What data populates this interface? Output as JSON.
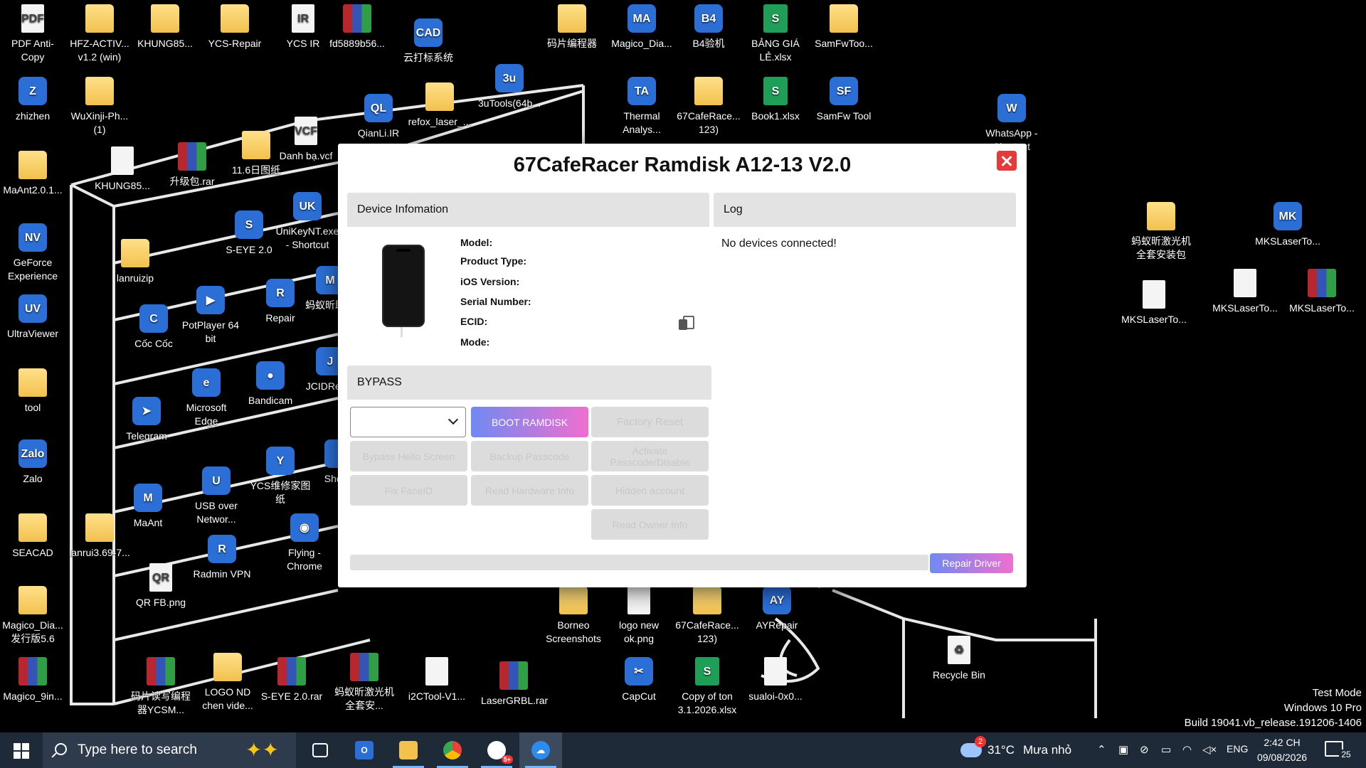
{
  "desktop_icons": [
    {
      "label": "PDF Anti-Copy",
      "type": "doc",
      "glyph": "PDF"
    },
    {
      "label": "HFZ-ACTIV... v1.2 (win)",
      "type": "folder",
      "glyph": ""
    },
    {
      "label": "KHUNG85...",
      "type": "folder",
      "glyph": ""
    },
    {
      "label": "YCS-Repair",
      "type": "folder",
      "glyph": ""
    },
    {
      "label": "YCS IR",
      "type": "doc",
      "glyph": "IR"
    },
    {
      "label": "fd5889b56...",
      "type": "rar",
      "glyph": ""
    },
    {
      "label": "云打标系统",
      "type": "app",
      "glyph": "CAD"
    },
    {
      "label": "码片编程器",
      "type": "folder",
      "glyph": ""
    },
    {
      "label": "Magico_Dia...",
      "type": "app",
      "glyph": "MA"
    },
    {
      "label": "B4验机",
      "type": "app",
      "glyph": "B4"
    },
    {
      "label": "BẢNG GIÁ LẺ.xlsx",
      "type": "xls",
      "glyph": "S"
    },
    {
      "label": "SamFwToo...",
      "type": "folder",
      "glyph": ""
    },
    {
      "label": "zhizhen",
      "type": "app",
      "glyph": "Z"
    },
    {
      "label": "WuXinji-Ph... (1)",
      "type": "folder",
      "glyph": ""
    },
    {
      "label": "refox_laser_...",
      "type": "folder",
      "glyph": ""
    },
    {
      "label": "QianLi.IR",
      "type": "app",
      "glyph": "QL"
    },
    {
      "label": "3uTools(64b...",
      "type": "app",
      "glyph": "3u"
    },
    {
      "label": "Thermal Analys...",
      "type": "app",
      "glyph": "TA"
    },
    {
      "label": "67CafeRace... 123)",
      "type": "folder",
      "glyph": ""
    },
    {
      "label": "Book1.xlsx",
      "type": "xls",
      "glyph": "S"
    },
    {
      "label": "SamFw Tool",
      "type": "app",
      "glyph": "SF"
    },
    {
      "label": "WhatsApp - Shortcut",
      "type": "app",
      "glyph": "W"
    },
    {
      "label": "MaAnt2.0.1...",
      "type": "folder",
      "glyph": ""
    },
    {
      "label": "KHUNG85...",
      "type": "doc",
      "glyph": ""
    },
    {
      "label": "升级包.rar",
      "type": "rar",
      "glyph": ""
    },
    {
      "label": "11.6日图纸",
      "type": "folder",
      "glyph": ""
    },
    {
      "label": "Danh bạ.vcf",
      "type": "doc",
      "glyph": "VCF"
    },
    {
      "label": "GeForce Experience",
      "type": "app",
      "glyph": "NV"
    },
    {
      "label": "S-EYE 2.0",
      "type": "app",
      "glyph": "S"
    },
    {
      "label": "UniKeyNT.exe - Shortcut",
      "type": "app",
      "glyph": "UK"
    },
    {
      "label": "lanruizip",
      "type": "folder",
      "glyph": ""
    },
    {
      "label": "UltraViewer",
      "type": "app",
      "glyph": "UV"
    },
    {
      "label": "PotPlayer 64 bit",
      "type": "app",
      "glyph": "▶"
    },
    {
      "label": "Repair",
      "type": "app",
      "glyph": "R"
    },
    {
      "label": "蚂蚁昕助手",
      "type": "app",
      "glyph": "M"
    },
    {
      "label": "Cốc Cốc",
      "type": "app",
      "glyph": "C"
    },
    {
      "label": "tool",
      "type": "folder",
      "glyph": ""
    },
    {
      "label": "Microsoft Edge",
      "type": "app",
      "glyph": "e"
    },
    {
      "label": "Bandicam",
      "type": "app",
      "glyph": "●"
    },
    {
      "label": "JCIDRep...",
      "type": "app",
      "glyph": "J"
    },
    {
      "label": "Telegram",
      "type": "app",
      "glyph": "➤"
    },
    {
      "label": "Zalo",
      "type": "app",
      "glyph": "Zalo"
    },
    {
      "label": "YCS维修家图纸",
      "type": "app",
      "glyph": "Y"
    },
    {
      "label": "Shor...",
      "type": "app",
      "glyph": ""
    },
    {
      "label": "USB over Networ...",
      "type": "app",
      "glyph": "U"
    },
    {
      "label": "MaAnt",
      "type": "app",
      "glyph": "M"
    },
    {
      "label": "SEACAD",
      "type": "folder",
      "glyph": ""
    },
    {
      "label": "lanrui3.69-7...",
      "type": "folder",
      "glyph": ""
    },
    {
      "label": "Radmin VPN",
      "type": "app",
      "glyph": "R"
    },
    {
      "label": "Flying - Chrome",
      "type": "app",
      "glyph": "◉"
    },
    {
      "label": "QR FB.png",
      "type": "doc",
      "glyph": "QR"
    },
    {
      "label": "Magico_Dia... 发行版5.6",
      "type": "folder",
      "glyph": ""
    },
    {
      "label": "Borneo Screenshots",
      "type": "folder",
      "glyph": ""
    },
    {
      "label": "logo new ok.png",
      "type": "doc",
      "glyph": ""
    },
    {
      "label": "67CafeRace... 123)",
      "type": "folder",
      "glyph": ""
    },
    {
      "label": "AYRepair",
      "type": "app",
      "glyph": "AY"
    },
    {
      "label": "蚂蚁昕激光机全套安装包",
      "type": "folder",
      "glyph": ""
    },
    {
      "label": "MKSLaserTo...",
      "type": "app",
      "glyph": "MK"
    },
    {
      "label": "MKSLaserTo...",
      "type": "doc",
      "glyph": ""
    },
    {
      "label": "MKSLaserTo...",
      "type": "doc",
      "glyph": ""
    },
    {
      "label": "MKSLaserTo...",
      "type": "rar",
      "glyph": ""
    },
    {
      "label": "Recycle Bin",
      "type": "doc",
      "glyph": "♻"
    },
    {
      "label": "Magico_9in...",
      "type": "rar",
      "glyph": ""
    },
    {
      "label": "码片读写编程器YCSM...",
      "type": "rar",
      "glyph": ""
    },
    {
      "label": "LOGO ND chen vide...",
      "type": "folder",
      "glyph": ""
    },
    {
      "label": "S-EYE 2.0.rar",
      "type": "rar",
      "glyph": ""
    },
    {
      "label": "蚂蚁昕激光机全套安...",
      "type": "rar",
      "glyph": ""
    },
    {
      "label": "i2CTool-V1...",
      "type": "doc",
      "glyph": ""
    },
    {
      "label": "LaserGRBL.rar",
      "type": "rar",
      "glyph": ""
    },
    {
      "label": "CapCut",
      "type": "app",
      "glyph": "✂"
    },
    {
      "label": "Copy of ton 3.1.2026.xlsx",
      "type": "xls",
      "glyph": "S"
    },
    {
      "label": "sualoi-0x0...",
      "type": "doc",
      "glyph": ""
    }
  ],
  "dialog": {
    "title": "67CafeRacer Ramdisk A12-13 V2.0",
    "device_section": "Device Infomation",
    "log_section": "Log",
    "bypass_section": "BYPASS",
    "info_labels": [
      "Model:",
      "Product Type:",
      "iOS Version:",
      "Serial Number:",
      "ECID:",
      "Mode:"
    ],
    "log_message": "No devices connected!",
    "select_value": "",
    "buttons": {
      "boot_ramdisk": "BOOT RAMDISK",
      "factory_reset": "Factory Reset",
      "bypass_hello": "Bypass Hello Screen",
      "backup_passcode": "Backup Passcode",
      "activate_passcode": "Activate Passcode/Disable",
      "fix_faceid": "Fix FaceID",
      "read_hardware": "Read Hardware Info",
      "hidden_account": "Hidden account",
      "read_owner": "Read Owner Info",
      "repair_driver": "Repair Driver"
    },
    "progress": 0
  },
  "system": {
    "watermark": [
      "Test Mode",
      "Windows 10 Pro",
      "Build 19041.vb_release.191206-1406"
    ]
  },
  "taskbar": {
    "search_placeholder": "Type here to search",
    "weather_temp": "31°C",
    "weather_desc": "Mưa nhỏ",
    "weather_badge": "2",
    "language": "ENG",
    "time": "2:42 CH",
    "date": "09/08/2026",
    "notification_count": "25",
    "zalo_badge": "5+",
    "apps": [
      {
        "name": "task-view",
        "glyph": "▯▯"
      },
      {
        "name": "outlook-app",
        "glyph": "O"
      },
      {
        "name": "file-explorer",
        "glyph": ""
      },
      {
        "name": "chrome",
        "glyph": "◉"
      },
      {
        "name": "zalo",
        "glyph": "Zalo"
      },
      {
        "name": "cloud-app",
        "glyph": "☁"
      }
    ]
  }
}
